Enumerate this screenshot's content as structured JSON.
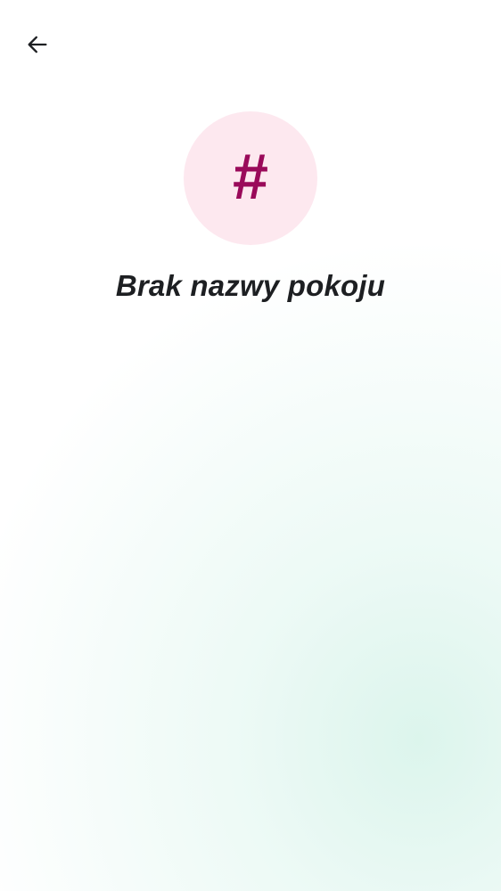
{
  "header": {
    "back_icon": "arrow-left-icon"
  },
  "room": {
    "avatar_glyph": "#",
    "avatar_icon": "hash-icon",
    "name": "Brak nazwy pokoju"
  },
  "colors": {
    "avatar_background": "#fde8ef",
    "avatar_glyph": "#9a0a5a",
    "title_text": "#1d1f22",
    "icon": "#1d1f22",
    "background_glow": "#e0f6ef"
  }
}
